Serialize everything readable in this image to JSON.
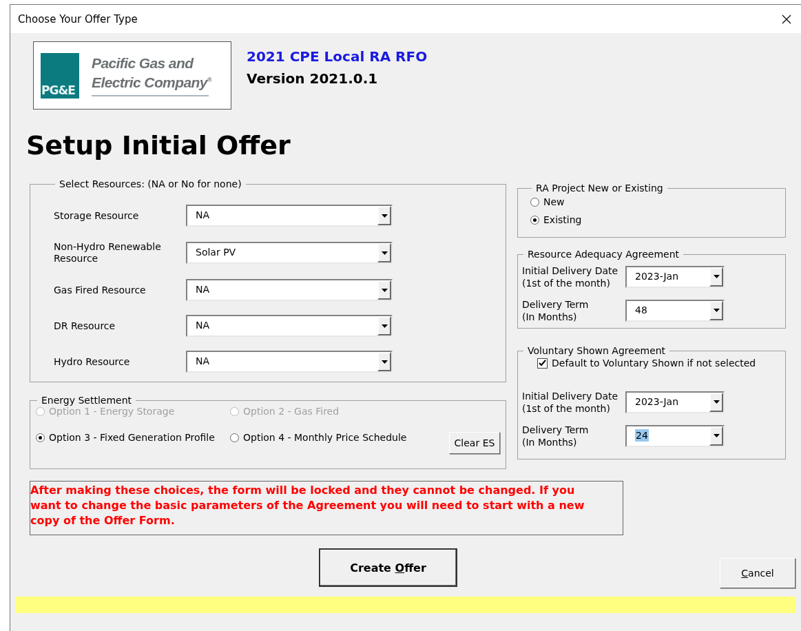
{
  "window": {
    "title": "Choose Your Offer Type"
  },
  "header": {
    "logo": {
      "mark_text": "PG&E",
      "company_lines": [
        "Pacific Gas and",
        "Electric Company"
      ],
      "registered": "®"
    },
    "rfo_title": "2021 CPE Local RA RFO",
    "version": "Version 2021.0.1"
  },
  "heading": "Setup Initial Offer",
  "resources": {
    "legend": "Select Resources: (NA or No for none)",
    "rows": [
      {
        "label": "Storage Resource",
        "value": "NA"
      },
      {
        "label": "Non-Hydro Renewable Resource",
        "value": "Solar PV"
      },
      {
        "label": "Gas Fired Resource",
        "value": "NA"
      },
      {
        "label": "DR Resource",
        "value": "NA"
      },
      {
        "label": "Hydro Resource",
        "value": "NA"
      }
    ]
  },
  "energy_settlement": {
    "legend": "Energy Settlement",
    "options": [
      {
        "label": "Option 1 - Energy Storage",
        "selected": false,
        "disabled": true
      },
      {
        "label": "Option 2 - Gas Fired",
        "selected": false,
        "disabled": true
      },
      {
        "label": "Option 3 - Fixed Generation Profile",
        "selected": true,
        "disabled": false
      },
      {
        "label": "Option 4 - Monthly Price Schedule",
        "selected": false,
        "disabled": false
      }
    ],
    "clear_button": "Clear ES"
  },
  "project": {
    "legend": "RA Project New or Existing",
    "options": [
      {
        "label": "New",
        "selected": false
      },
      {
        "label": "Existing",
        "selected": true
      }
    ]
  },
  "ra_agreement": {
    "legend": "Resource Adequacy Agreement",
    "fields": [
      {
        "label_lines": [
          "Initial Delivery Date",
          "(1st of the month)"
        ],
        "value": "2023-Jan",
        "text_selected": false
      },
      {
        "label_lines": [
          "Delivery Term",
          "(In Months)"
        ],
        "value": "48",
        "text_selected": false
      }
    ]
  },
  "voluntary": {
    "legend": "Voluntary Shown Agreement",
    "checkbox": {
      "label": "Default to Voluntary Shown if not selected",
      "checked": true
    },
    "fields": [
      {
        "label_lines": [
          "Initial Delivery Date",
          "(1st of the month)"
        ],
        "value": "2023-Jan",
        "text_selected": false
      },
      {
        "label_lines": [
          "Delivery Term",
          "(In Months)"
        ],
        "value": "24",
        "text_selected": true
      }
    ]
  },
  "warning": "After making these choices, the form will be locked and they cannot be changed. If you want to change the basic parameters of the Agreement you will need to start with a new copy of the Offer Form.",
  "buttons": [
    {
      "kind": "primary",
      "pre": "Create ",
      "key": "O",
      "post": "ffer"
    },
    {
      "kind": "cancel",
      "key": "C",
      "post": "ancel"
    }
  ]
}
